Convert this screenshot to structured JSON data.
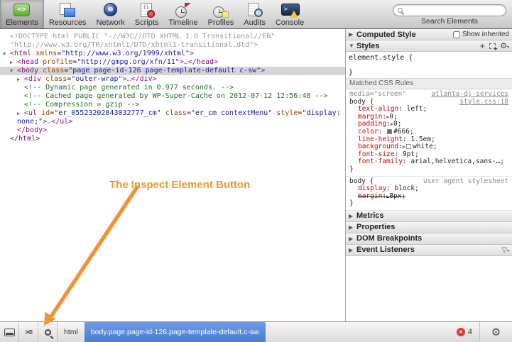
{
  "glyphs": {
    "tri_down": "▼",
    "tri_right": "▶",
    "plus": "+",
    "gear": "⚙",
    "funnel": "▽",
    "dropdown": "▾",
    "error_x": "✕",
    "console_prompt": ">≡",
    "dots": "…"
  },
  "toolbar": {
    "buttons": [
      {
        "label": "Elements",
        "selected": true
      },
      {
        "label": "Resources",
        "selected": false
      },
      {
        "label": "Network",
        "selected": false
      },
      {
        "label": "Scripts",
        "selected": false
      },
      {
        "label": "Timeline",
        "selected": false
      },
      {
        "label": "Profiles",
        "selected": false
      },
      {
        "label": "Audits",
        "selected": false
      },
      {
        "label": "Console",
        "selected": false
      }
    ],
    "search": {
      "value": "",
      "label": "Search Elements"
    }
  },
  "dom_tree": {
    "lines": [
      {
        "indent": 0,
        "arrow": null,
        "selected": false,
        "tokens": [
          {
            "t": "doctype",
            "s": "<!DOCTYPE html PUBLIC \"-//W3C//DTD XHTML 1.0 Transitional//EN\""
          }
        ]
      },
      {
        "indent": 0,
        "arrow": null,
        "selected": false,
        "tokens": [
          {
            "t": "doctype",
            "s": "\"http://www.w3.org/TR/xhtml1/DTD/xhtml1-transitional.dtd\">"
          }
        ]
      },
      {
        "indent": 0,
        "arrow": "down",
        "selected": false,
        "tokens": [
          {
            "t": "tag",
            "s": "<html"
          },
          {
            "t": "plain",
            "s": " "
          },
          {
            "t": "attr",
            "s": "xmlns"
          },
          {
            "t": "plain",
            "s": "="
          },
          {
            "t": "val",
            "s": "\"http://www.w3.org/1999/xhtml\""
          },
          {
            "t": "tag",
            "s": ">"
          }
        ]
      },
      {
        "indent": 1,
        "arrow": "right",
        "selected": false,
        "tokens": [
          {
            "t": "tag",
            "s": "<head"
          },
          {
            "t": "plain",
            "s": " "
          },
          {
            "t": "attr",
            "s": "profile"
          },
          {
            "t": "plain",
            "s": "="
          },
          {
            "t": "val",
            "s": "\"http://gmpg.org/xfn/11\""
          },
          {
            "t": "tag",
            "s": ">"
          },
          {
            "t": "dots",
            "s": "…"
          },
          {
            "t": "tag",
            "s": "</head>"
          }
        ]
      },
      {
        "indent": 1,
        "arrow": "down",
        "selected": true,
        "tokens": [
          {
            "t": "tag",
            "s": "<body"
          },
          {
            "t": "plain",
            "s": " "
          },
          {
            "t": "attr",
            "s": "class"
          },
          {
            "t": "plain",
            "s": "="
          },
          {
            "t": "val",
            "s": "\"page page-id-126 page-template-default c-sw\""
          },
          {
            "t": "tag",
            "s": ">"
          }
        ]
      },
      {
        "indent": 2,
        "arrow": "right",
        "selected": false,
        "tokens": [
          {
            "t": "tag",
            "s": "<div"
          },
          {
            "t": "plain",
            "s": " "
          },
          {
            "t": "attr",
            "s": "class"
          },
          {
            "t": "plain",
            "s": "="
          },
          {
            "t": "val",
            "s": "\"outer-wrap\""
          },
          {
            "t": "tag",
            "s": ">"
          },
          {
            "t": "dots",
            "s": "…"
          },
          {
            "t": "tag",
            "s": "</div>"
          }
        ]
      },
      {
        "indent": 2,
        "arrow": null,
        "selected": false,
        "tokens": [
          {
            "t": "comment",
            "s": "<!-- Dynamic page generated in 0.977 seconds. -->"
          }
        ]
      },
      {
        "indent": 2,
        "arrow": null,
        "selected": false,
        "tokens": [
          {
            "t": "comment",
            "s": "<!-- Cached page generated by WP-Super-Cache on 2012-07-12 12:56:48 -->"
          }
        ]
      },
      {
        "indent": 2,
        "arrow": null,
        "selected": false,
        "tokens": [
          {
            "t": "comment",
            "s": "<!-- Compression = gzip -->"
          }
        ]
      },
      {
        "indent": 2,
        "arrow": "right",
        "selected": false,
        "tokens": [
          {
            "t": "tag",
            "s": "<ul"
          },
          {
            "t": "plain",
            "s": " "
          },
          {
            "t": "attr",
            "s": "id"
          },
          {
            "t": "plain",
            "s": "="
          },
          {
            "t": "val",
            "s": "\"er_05523202843032777_cm\""
          },
          {
            "t": "plain",
            "s": " "
          },
          {
            "t": "attr",
            "s": "class"
          },
          {
            "t": "plain",
            "s": "="
          },
          {
            "t": "val",
            "s": "\"er_cm contextMenu\""
          },
          {
            "t": "plain",
            "s": " "
          },
          {
            "t": "attr",
            "s": "style"
          },
          {
            "t": "plain",
            "s": "="
          },
          {
            "t": "val",
            "s": "\"display:"
          }
        ]
      },
      {
        "indent": 1,
        "arrow": null,
        "selected": false,
        "tokens": [
          {
            "t": "val",
            "s": "none;\""
          },
          {
            "t": "tag",
            "s": ">"
          },
          {
            "t": "dots",
            "s": "…"
          },
          {
            "t": "tag",
            "s": "</ul>"
          }
        ]
      },
      {
        "indent": 1,
        "arrow": null,
        "selected": false,
        "tokens": [
          {
            "t": "tag",
            "s": "</body>"
          }
        ]
      },
      {
        "indent": 0,
        "arrow": null,
        "selected": false,
        "tokens": [
          {
            "t": "tag",
            "s": "</html>"
          }
        ]
      }
    ]
  },
  "annotation": {
    "text": "The Inspect Element Button",
    "color": "#ef9434"
  },
  "sidebar": {
    "computed_style": {
      "label": "Computed Style",
      "show_inherited": "Show inherited"
    },
    "styles": {
      "label": "Styles"
    },
    "element_style": {
      "header": "element.style {",
      "close": "}"
    },
    "matched_rules_label": "Matched CSS Rules",
    "rules": [
      {
        "media": "media=\"screen\"",
        "media_link": "atlanta-dj-services",
        "selector": "body {",
        "link": "style.css:18",
        "link_underline": true,
        "props": [
          {
            "name": "text-align",
            "value": "left"
          },
          {
            "name": "margin",
            "value": "0",
            "arrow": true
          },
          {
            "name": "padding",
            "value": "0",
            "arrow": true
          },
          {
            "name": "color",
            "value": "#666",
            "swatch": "#666666"
          },
          {
            "name": "line-height",
            "value": "1.5em"
          },
          {
            "name": "background",
            "value": "white",
            "arrow": true,
            "swatch": "#ffffff"
          },
          {
            "name": "font-size",
            "value": "9pt"
          },
          {
            "name": "font-family",
            "value": "arial,helvetica,sans-…"
          }
        ],
        "close": "}"
      },
      {
        "selector": "body {",
        "link": "user agent stylesheet",
        "link_underline": false,
        "props": [
          {
            "name": "display",
            "value": "block"
          },
          {
            "name": "margin",
            "value": "8px",
            "arrow": true,
            "struck": true
          }
        ],
        "close": "}"
      }
    ],
    "sections": [
      "Metrics",
      "Properties",
      "DOM Breakpoints",
      "Event Listeners"
    ]
  },
  "statusbar": {
    "breadcrumbs": [
      {
        "label": "html",
        "selected": false
      },
      {
        "label": "body.page.page-id-126.page-template-default.c-sw",
        "selected": true
      }
    ],
    "error_count": "4"
  }
}
